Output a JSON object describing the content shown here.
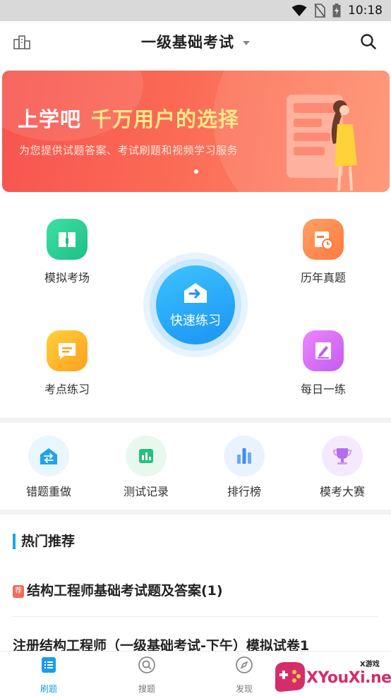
{
  "status_bar": {
    "time": "10:18",
    "icons": [
      "wifi-icon",
      "no-sim-icon",
      "battery-charging-icon"
    ]
  },
  "header": {
    "title": "一级基础考试",
    "left_icon": "buildings-icon",
    "right_icon": "search-icon"
  },
  "banner": {
    "headline_1": "上学吧",
    "headline_2": "千万用户的选择",
    "subtitle": "为您提供试题答案、考试刷题和视频学习服务",
    "colors": {
      "start": "#f7544f",
      "end": "#ff8f6b",
      "highlight": "#ffe88a"
    }
  },
  "quick_grid": {
    "items": [
      {
        "label": "模拟考场",
        "icon": "book-icon",
        "color": "#1dbf83"
      },
      {
        "label": "历年真题",
        "icon": "calendar-clock-icon",
        "color": "#ff7a3d"
      },
      {
        "label": "考点练习",
        "icon": "chat-lines-icon",
        "color": "#ff9f1e"
      },
      {
        "label": "每日一练",
        "icon": "pencil-note-icon",
        "color": "#c25cf0"
      }
    ],
    "center": {
      "label": "快速练习",
      "icon": "arrow-house-icon",
      "color": "#1a93f3"
    }
  },
  "tools": {
    "items": [
      {
        "label": "错题重做",
        "icon": "redo-house-icon",
        "color": "#1fa4ea"
      },
      {
        "label": "测试记录",
        "icon": "bar-record-icon",
        "color": "#26c07e"
      },
      {
        "label": "排行榜",
        "icon": "ranking-bars-icon",
        "color": "#3b8cf5"
      },
      {
        "label": "模考大赛",
        "icon": "trophy-icon",
        "color": "#b56cf0"
      }
    ]
  },
  "hot": {
    "title": "热门推荐",
    "articles": [
      {
        "tag": "荐",
        "title": "结构工程师基础考试题及答案(1)"
      },
      {
        "title": "注册结构工程师（一级基础考试-下午）模拟试卷1"
      }
    ]
  },
  "bottom_nav": {
    "items": [
      {
        "label": "刷题",
        "icon": "list-doc-icon",
        "active": true
      },
      {
        "label": "搜题",
        "icon": "search-circle-icon",
        "active": false
      },
      {
        "label": "发现",
        "icon": "compass-icon",
        "active": false
      }
    ],
    "active_color": "#1a9df0"
  },
  "watermark": {
    "brand": "XYouXi.net",
    "small": "X游戏"
  }
}
